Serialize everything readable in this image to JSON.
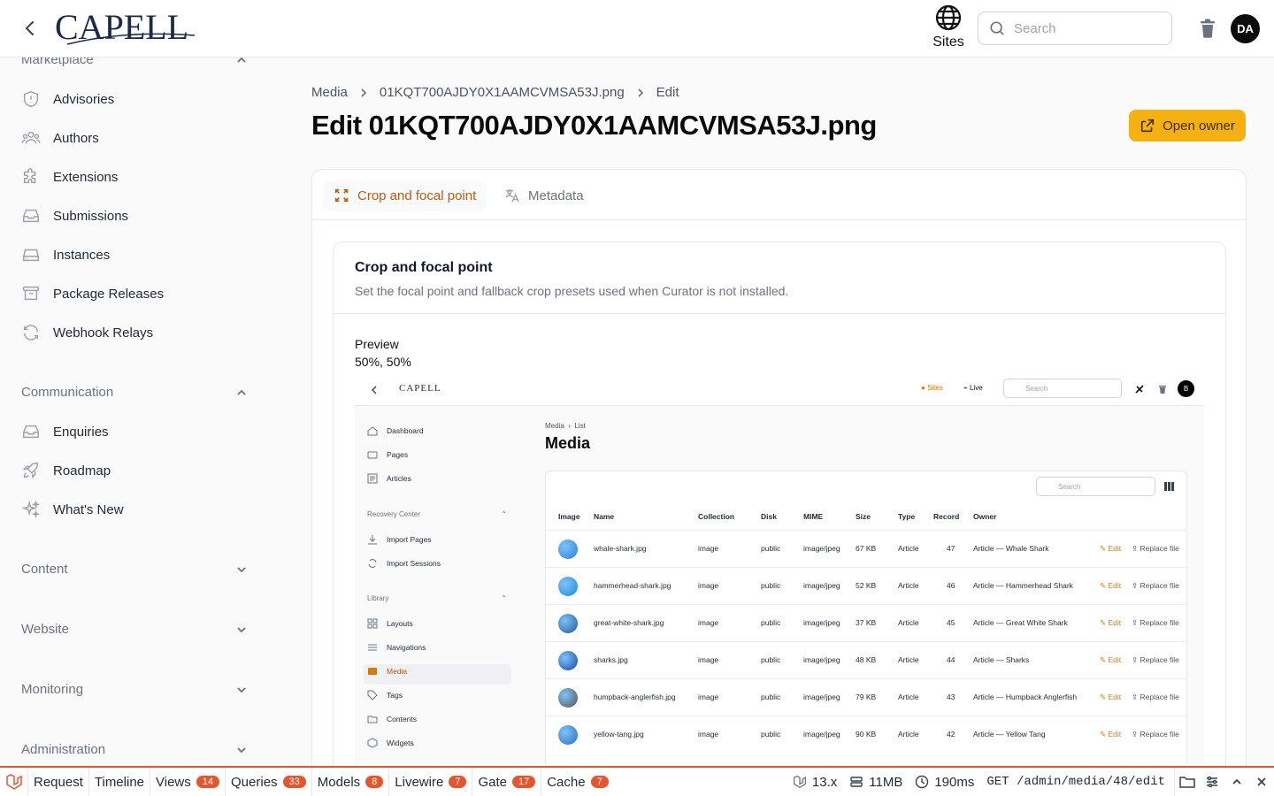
{
  "header": {
    "brand": "CAPELL",
    "sites_label": "Sites",
    "search_placeholder": "Search",
    "avatar_initials": "DA"
  },
  "sidebar": {
    "groups": [
      {
        "label": "Marketplace",
        "expanded": true,
        "items": [
          "Advisories",
          "Authors",
          "Extensions",
          "Submissions",
          "Instances",
          "Package Releases",
          "Webhook Relays"
        ]
      },
      {
        "label": "Communication",
        "expanded": true,
        "items": [
          "Enquiries",
          "Roadmap",
          "What's New"
        ]
      },
      {
        "label": "Content",
        "expanded": false
      },
      {
        "label": "Website",
        "expanded": false
      },
      {
        "label": "Monitoring",
        "expanded": false
      },
      {
        "label": "Administration",
        "expanded": false
      }
    ]
  },
  "breadcrumb": [
    "Media",
    "01KQT700AJDY0X1AAMCVMSA53J.png",
    "Edit"
  ],
  "page_title": "Edit 01KQT700AJDY0X1AAMCVMSA53J.png",
  "owner_button": "Open owner",
  "tabs": [
    {
      "label": "Crop and focal point",
      "active": true
    },
    {
      "label": "Metadata",
      "active": false
    }
  ],
  "section": {
    "title": "Crop and focal point",
    "description": "Set the focal point and fallback crop presets used when Curator is not installed.",
    "preview_label": "Preview",
    "preview_value": "50%, 50%"
  },
  "preview": {
    "brand": "CAPELL",
    "sites": "Sites",
    "live": "Live",
    "search": "Search",
    "avatar": "B",
    "nav_top": [
      "Dashboard",
      "Pages",
      "Articles"
    ],
    "group_recovery": "Recovery Center",
    "nav_recovery": [
      "Import Pages",
      "Import Sessions"
    ],
    "group_library": "Library",
    "nav_library": [
      "Layouts",
      "Navigations",
      "Media",
      "Tags",
      "Contents",
      "Widgets"
    ],
    "breadcrumb": [
      "Media",
      "List"
    ],
    "title": "Media",
    "table_search": "Search",
    "columns": [
      "Image",
      "Name",
      "Collection",
      "Disk",
      "MIME",
      "Size",
      "Type",
      "Record",
      "Owner"
    ],
    "edit_label": "Edit",
    "replace_label": "Replace file",
    "rows": [
      {
        "name": "whale-shark.jpg",
        "collection": "image",
        "disk": "public",
        "mime": "image/jpeg",
        "size": "67 KB",
        "type": "Article",
        "record": "47",
        "owner": "Article — Whale Shark",
        "color": "#2a7fd4"
      },
      {
        "name": "hammerhead-shark.jpg",
        "collection": "image",
        "disk": "public",
        "mime": "image/jpeg",
        "size": "52 KB",
        "type": "Article",
        "record": "46",
        "owner": "Article — Hammerhead Shark",
        "color": "#1d8ccf"
      },
      {
        "name": "great-white-shark.jpg",
        "collection": "image",
        "disk": "public",
        "mime": "image/jpeg",
        "size": "37 KB",
        "type": "Article",
        "record": "45",
        "owner": "Article — Great White Shark",
        "color": "#24578a"
      },
      {
        "name": "sharks.jpg",
        "collection": "image",
        "disk": "public",
        "mime": "image/jpeg",
        "size": "48 KB",
        "type": "Article",
        "record": "44",
        "owner": "Article — Sharks",
        "color": "#1746a0"
      },
      {
        "name": "humpback-anglerfish.jpg",
        "collection": "image",
        "disk": "public",
        "mime": "image/jpeg",
        "size": "79 KB",
        "type": "Article",
        "record": "43",
        "owner": "Article — Humpback Anglerfish",
        "color": "#5b5249"
      },
      {
        "name": "yellow-tang.jpg",
        "collection": "image",
        "disk": "public",
        "mime": "image/jpeg",
        "size": "90 KB",
        "type": "Article",
        "record": "42",
        "owner": "Article — Yellow Tang",
        "color": "#2a6fb8"
      }
    ]
  },
  "debugbar": {
    "tabs": [
      {
        "label": "Request",
        "count": ""
      },
      {
        "label": "Timeline",
        "count": ""
      },
      {
        "label": "Views",
        "count": "14"
      },
      {
        "label": "Queries",
        "count": "33"
      },
      {
        "label": "Models",
        "count": "8"
      },
      {
        "label": "Livewire",
        "count": "7"
      },
      {
        "label": "Gate",
        "count": "17"
      },
      {
        "label": "Cache",
        "count": "7"
      }
    ],
    "version": "13.x",
    "memory": "11MB",
    "time": "190ms",
    "route": "GET /admin/media/48/edit"
  },
  "colors": {
    "accent": "#f5b111",
    "active_tab": "#c2590c",
    "debug_accent": "#e4572e"
  }
}
